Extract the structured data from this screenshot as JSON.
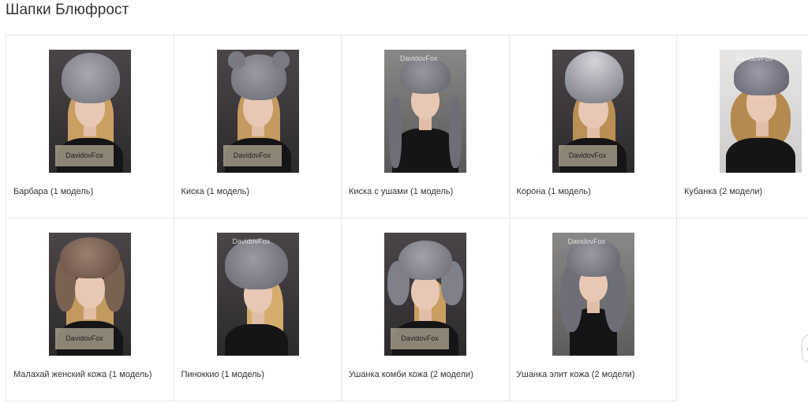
{
  "page": {
    "title": "Шапки Блюфрост"
  },
  "brand": {
    "name": "DavidovFox"
  },
  "products": [
    {
      "caption": "Барбара (1 модель)"
    },
    {
      "caption": "Киска (1 модель)"
    },
    {
      "caption": "Киска с ушами (1 модель)"
    },
    {
      "caption": "Корона (1 модель)"
    },
    {
      "caption": "Кубанка (2 модели)"
    },
    {
      "caption": "Малахай женский кожа (1 модель)"
    },
    {
      "caption": "Пиноккио (1 модель)"
    },
    {
      "caption": "Ушанка комби кожа (2 модели)"
    },
    {
      "caption": "Ушанка элит кожа (2 модели)"
    }
  ],
  "colors": {
    "border": "#e6e6e6",
    "text": "#333333",
    "fur_silver": "#8a8a94",
    "fur_brown": "#7a6252",
    "photo_bg": "#3a393c"
  },
  "icons": {
    "scroll_button": "chevron-icon"
  }
}
